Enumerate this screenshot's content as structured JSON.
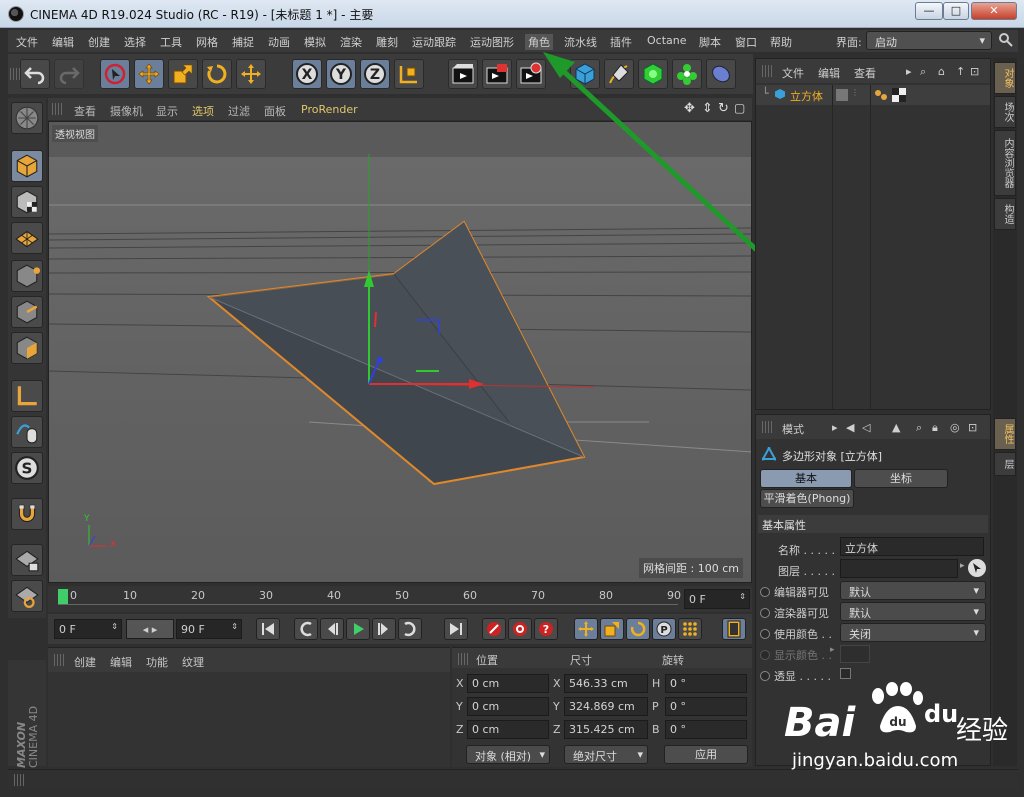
{
  "window": {
    "title": "CINEMA 4D R19.024 Studio (RC - R19) - [未标题 1 *] - 主要",
    "minimize": "—",
    "maximize": "□",
    "close": "✕"
  },
  "menubar": {
    "items": [
      "文件",
      "编辑",
      "创建",
      "选择",
      "工具",
      "网格",
      "捕捉",
      "动画",
      "模拟",
      "渲染",
      "雕刻",
      "运动跟踪",
      "运动图形",
      "角色",
      "流水线",
      "插件",
      "Octane",
      "脚本",
      "窗口",
      "帮助"
    ],
    "active": "角色"
  },
  "layout": {
    "label": "界面:",
    "value": "启动"
  },
  "toolbar": {
    "icons": [
      "undo-icon",
      "redo-icon",
      "live-select-icon",
      "move-icon",
      "scale-icon",
      "rotate-icon",
      "transform-icon",
      "x-axis-icon",
      "y-axis-icon",
      "z-axis-icon",
      "coordinate-system-icon",
      "render-view-icon",
      "render-picture-viewer-icon",
      "render-settings-icon",
      "cube-primitive-icon",
      "pen-spline-icon",
      "subdivision-icon",
      "cloner-icon",
      "deformer-icon"
    ]
  },
  "viewport": {
    "menu": [
      "查看",
      "摄像机",
      "显示",
      "选项",
      "过滤",
      "面板",
      "ProRender"
    ],
    "highlight": "选项",
    "label": "透视视图",
    "grid_spacing": "网格间距 : 100 cm",
    "axis_labels": {
      "x": "X",
      "y": "Y"
    }
  },
  "timeline": {
    "ticks": [
      "0",
      "10",
      "20",
      "30",
      "40",
      "50",
      "60",
      "70",
      "80",
      "90"
    ],
    "current_field": "0 F"
  },
  "playbar": {
    "start": "0 F",
    "end": "90 F"
  },
  "material_panel": {
    "menu": [
      "创建",
      "编辑",
      "功能",
      "纹理"
    ]
  },
  "coords": {
    "headers": [
      "位置",
      "尺寸",
      "旋转"
    ],
    "rows": [
      {
        "pos_label": "X",
        "pos": "0 cm",
        "size_label": "X",
        "size": "546.33 cm",
        "rot_label": "H",
        "rot": "0 °"
      },
      {
        "pos_label": "Y",
        "pos": "0 cm",
        "size_label": "Y",
        "size": "324.869 cm",
        "rot_label": "P",
        "rot": "0 °"
      },
      {
        "pos_label": "Z",
        "pos": "0 cm",
        "size_label": "Z",
        "size": "315.425 cm",
        "rot_label": "B",
        "rot": "0 °"
      }
    ],
    "mode": "对象 (相对)",
    "size_mode": "绝对尺寸",
    "apply": "应用"
  },
  "object_manager": {
    "menu": [
      "文件",
      "编辑",
      "查看"
    ],
    "object_name": "立方体"
  },
  "attribute_manager": {
    "mode": "模式",
    "object_title": "多边形对象 [立方体]",
    "tabs": [
      "基本",
      "坐标"
    ],
    "subtab": "平滑着色(Phong)",
    "section": "基本属性",
    "rows": [
      {
        "label": "名称 . . . . .",
        "value": "立方体"
      },
      {
        "label": "图层 . . . . .",
        "value": ""
      },
      {
        "label": "编辑器可见",
        "value": "默认"
      },
      {
        "label": "渲染器可见",
        "value": "默认"
      },
      {
        "label": "使用颜色 . .",
        "value": "关闭"
      },
      {
        "label": "显示颜色 . .",
        "value": ""
      },
      {
        "label": "透显 . . . . .",
        "value": ""
      }
    ]
  },
  "right_tabs": [
    "对象",
    "场次",
    "内容浏览器",
    "构造",
    "属性",
    "层"
  ],
  "logo": {
    "line1": "MAXON",
    "line2": "CINEMA 4D"
  },
  "watermark": {
    "brand": "Bai",
    "brand2": "du",
    "jingyan": "经验",
    "url": "jingyan.baidu.com"
  },
  "colors": {
    "accent": "#e2c66a",
    "selected": "#6b7f9a",
    "object_outline": "#e0882a",
    "arrow": "#1f9a2a"
  }
}
